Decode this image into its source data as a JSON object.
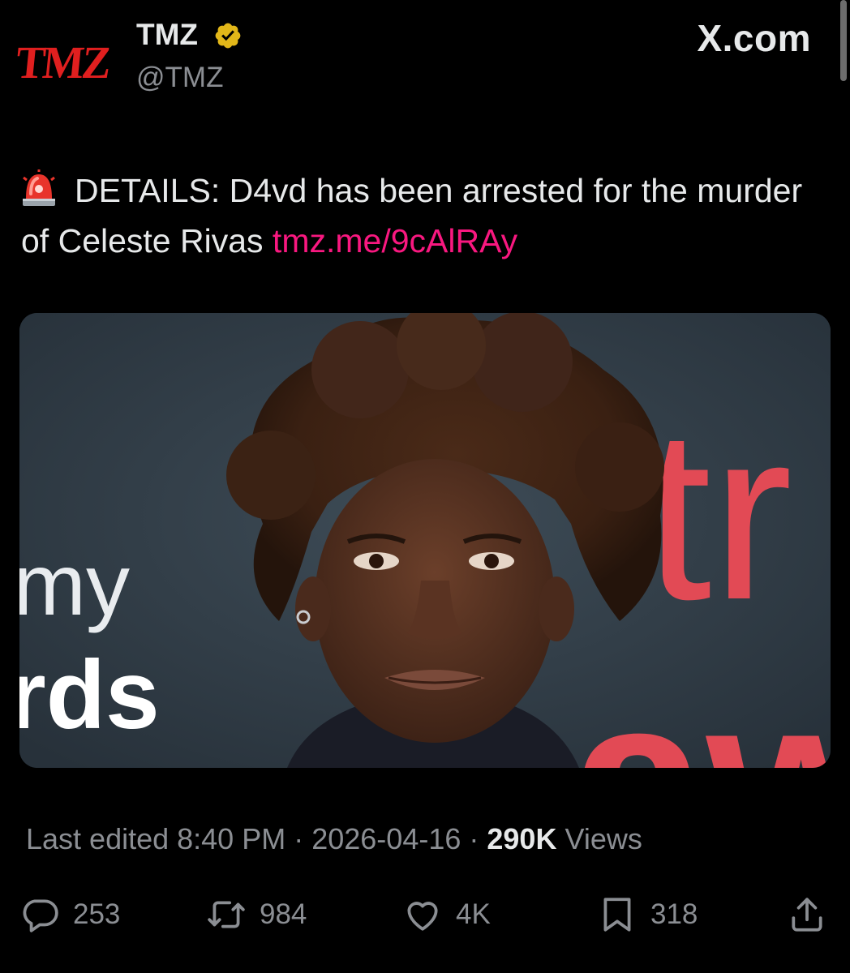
{
  "header": {
    "avatar_text": "TMZ",
    "display_name": "TMZ",
    "handle": "@TMZ",
    "source_label": "X.com",
    "verified_color": "#e2b719"
  },
  "tweet": {
    "emoji": "siren-emoji",
    "text": "DETAILS: D4vd has been arrested for the murder of Celeste Rivas",
    "link": "tmz.me/9cAlRAy",
    "link_color": "#f91880"
  },
  "media": {
    "description_icon": "photo",
    "backdrop_text_left_1": "my",
    "backdrop_text_left_2": "rds",
    "backdrop_text_right_1": "tr",
    "backdrop_text_right_2": "aw"
  },
  "meta": {
    "edited_label": "Last edited 8:40 PM",
    "date": "2026-04-16",
    "views_count": "290K",
    "views_label": "Views"
  },
  "actions": {
    "replies": "253",
    "reposts": "984",
    "likes": "4K",
    "bookmarks": "318"
  },
  "colors": {
    "background": "#000000",
    "text": "#e7e9ea",
    "secondary": "#8b8e93",
    "brand_red": "#e01f1f"
  }
}
